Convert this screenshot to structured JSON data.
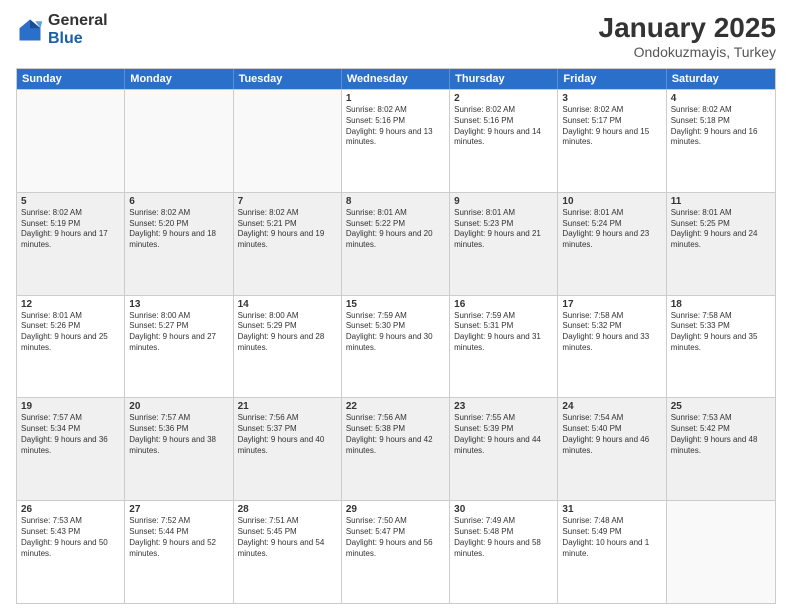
{
  "logo": {
    "general": "General",
    "blue": "Blue"
  },
  "header": {
    "month": "January 2025",
    "location": "Ondokuzmayis, Turkey"
  },
  "weekdays": [
    "Sunday",
    "Monday",
    "Tuesday",
    "Wednesday",
    "Thursday",
    "Friday",
    "Saturday"
  ],
  "rows": [
    [
      {
        "day": "",
        "text": "",
        "empty": true
      },
      {
        "day": "",
        "text": "",
        "empty": true
      },
      {
        "day": "",
        "text": "",
        "empty": true
      },
      {
        "day": "1",
        "text": "Sunrise: 8:02 AM\nSunset: 5:16 PM\nDaylight: 9 hours and 13 minutes."
      },
      {
        "day": "2",
        "text": "Sunrise: 8:02 AM\nSunset: 5:16 PM\nDaylight: 9 hours and 14 minutes."
      },
      {
        "day": "3",
        "text": "Sunrise: 8:02 AM\nSunset: 5:17 PM\nDaylight: 9 hours and 15 minutes."
      },
      {
        "day": "4",
        "text": "Sunrise: 8:02 AM\nSunset: 5:18 PM\nDaylight: 9 hours and 16 minutes."
      }
    ],
    [
      {
        "day": "5",
        "text": "Sunrise: 8:02 AM\nSunset: 5:19 PM\nDaylight: 9 hours and 17 minutes."
      },
      {
        "day": "6",
        "text": "Sunrise: 8:02 AM\nSunset: 5:20 PM\nDaylight: 9 hours and 18 minutes."
      },
      {
        "day": "7",
        "text": "Sunrise: 8:02 AM\nSunset: 5:21 PM\nDaylight: 9 hours and 19 minutes."
      },
      {
        "day": "8",
        "text": "Sunrise: 8:01 AM\nSunset: 5:22 PM\nDaylight: 9 hours and 20 minutes."
      },
      {
        "day": "9",
        "text": "Sunrise: 8:01 AM\nSunset: 5:23 PM\nDaylight: 9 hours and 21 minutes."
      },
      {
        "day": "10",
        "text": "Sunrise: 8:01 AM\nSunset: 5:24 PM\nDaylight: 9 hours and 23 minutes."
      },
      {
        "day": "11",
        "text": "Sunrise: 8:01 AM\nSunset: 5:25 PM\nDaylight: 9 hours and 24 minutes."
      }
    ],
    [
      {
        "day": "12",
        "text": "Sunrise: 8:01 AM\nSunset: 5:26 PM\nDaylight: 9 hours and 25 minutes."
      },
      {
        "day": "13",
        "text": "Sunrise: 8:00 AM\nSunset: 5:27 PM\nDaylight: 9 hours and 27 minutes."
      },
      {
        "day": "14",
        "text": "Sunrise: 8:00 AM\nSunset: 5:29 PM\nDaylight: 9 hours and 28 minutes."
      },
      {
        "day": "15",
        "text": "Sunrise: 7:59 AM\nSunset: 5:30 PM\nDaylight: 9 hours and 30 minutes."
      },
      {
        "day": "16",
        "text": "Sunrise: 7:59 AM\nSunset: 5:31 PM\nDaylight: 9 hours and 31 minutes."
      },
      {
        "day": "17",
        "text": "Sunrise: 7:58 AM\nSunset: 5:32 PM\nDaylight: 9 hours and 33 minutes."
      },
      {
        "day": "18",
        "text": "Sunrise: 7:58 AM\nSunset: 5:33 PM\nDaylight: 9 hours and 35 minutes."
      }
    ],
    [
      {
        "day": "19",
        "text": "Sunrise: 7:57 AM\nSunset: 5:34 PM\nDaylight: 9 hours and 36 minutes."
      },
      {
        "day": "20",
        "text": "Sunrise: 7:57 AM\nSunset: 5:36 PM\nDaylight: 9 hours and 38 minutes."
      },
      {
        "day": "21",
        "text": "Sunrise: 7:56 AM\nSunset: 5:37 PM\nDaylight: 9 hours and 40 minutes."
      },
      {
        "day": "22",
        "text": "Sunrise: 7:56 AM\nSunset: 5:38 PM\nDaylight: 9 hours and 42 minutes."
      },
      {
        "day": "23",
        "text": "Sunrise: 7:55 AM\nSunset: 5:39 PM\nDaylight: 9 hours and 44 minutes."
      },
      {
        "day": "24",
        "text": "Sunrise: 7:54 AM\nSunset: 5:40 PM\nDaylight: 9 hours and 46 minutes."
      },
      {
        "day": "25",
        "text": "Sunrise: 7:53 AM\nSunset: 5:42 PM\nDaylight: 9 hours and 48 minutes."
      }
    ],
    [
      {
        "day": "26",
        "text": "Sunrise: 7:53 AM\nSunset: 5:43 PM\nDaylight: 9 hours and 50 minutes."
      },
      {
        "day": "27",
        "text": "Sunrise: 7:52 AM\nSunset: 5:44 PM\nDaylight: 9 hours and 52 minutes."
      },
      {
        "day": "28",
        "text": "Sunrise: 7:51 AM\nSunset: 5:45 PM\nDaylight: 9 hours and 54 minutes."
      },
      {
        "day": "29",
        "text": "Sunrise: 7:50 AM\nSunset: 5:47 PM\nDaylight: 9 hours and 56 minutes."
      },
      {
        "day": "30",
        "text": "Sunrise: 7:49 AM\nSunset: 5:48 PM\nDaylight: 9 hours and 58 minutes."
      },
      {
        "day": "31",
        "text": "Sunrise: 7:48 AM\nSunset: 5:49 PM\nDaylight: 10 hours and 1 minute."
      },
      {
        "day": "",
        "text": "",
        "empty": true
      }
    ]
  ]
}
